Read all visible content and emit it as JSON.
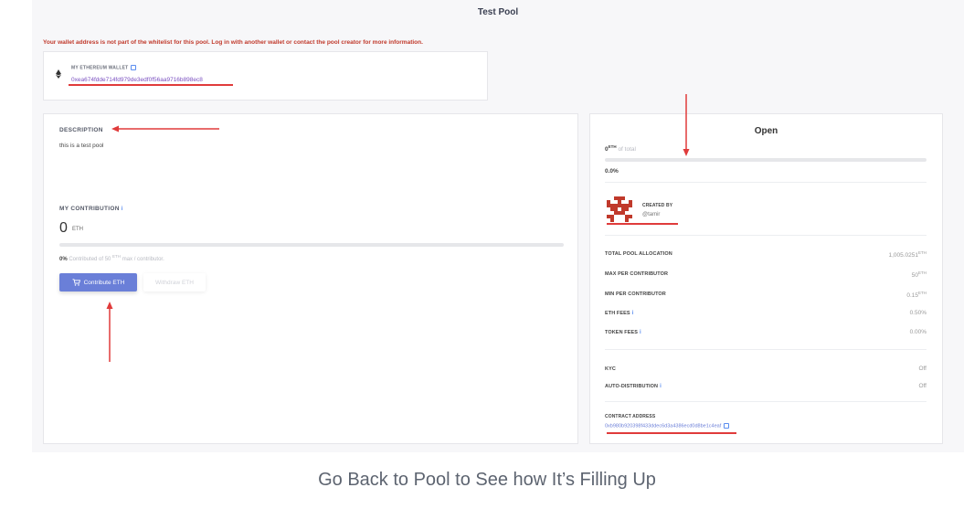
{
  "page": {
    "title": "Test Pool",
    "warning": "Your wallet address is not part of the whitelist for this pool. Log in with another wallet or contact the pool creator for more information."
  },
  "wallet": {
    "label": "MY ETHEREUM WALLET",
    "address": "0xea674fdde714fd979de3edf0f56aa9716b898ec8"
  },
  "description": {
    "label": "DESCRIPTION",
    "text": "this is a test pool"
  },
  "contribution": {
    "label": "MY CONTRIBUTION",
    "value": "0",
    "unit": "ETH",
    "percent": "0%",
    "detail_prefix": "Contributed of 50",
    "detail_unit": "ETH",
    "detail_suffix": "max / contributor.",
    "progress": 0,
    "contribute_label": "Contribute ETH",
    "withdraw_label": "Withdraw ETH"
  },
  "status": {
    "title": "Open",
    "total_value": "0",
    "total_unit": "ETH",
    "total_suffix": "of total",
    "percent": "0.0%",
    "progress": 0
  },
  "creator": {
    "label": "CREATED BY",
    "handle": "@tamir"
  },
  "stats": [
    {
      "label": "TOTAL POOL ALLOCATION",
      "value": "1,005.0251",
      "unit": "ETH",
      "info": false
    },
    {
      "label": "MAX PER CONTRIBUTOR",
      "value": "50",
      "unit": "ETH",
      "info": false
    },
    {
      "label": "MIN PER CONTRIBUTOR",
      "value": "0.15",
      "unit": "ETH",
      "info": false
    },
    {
      "label": "ETH FEES",
      "value": "0.50%",
      "unit": "",
      "info": true
    },
    {
      "label": "TOKEN FEES",
      "value": "0.00%",
      "unit": "",
      "info": true
    }
  ],
  "settings": [
    {
      "label": "KYC",
      "value": "Off",
      "info": false
    },
    {
      "label": "AUTO-DISTRIBUTION",
      "value": "Off",
      "info": true
    }
  ],
  "contract": {
    "label": "CONTRACT ADDRESS",
    "address": "0xb980b920398f433ddec6d3a4386ecd0d8be1c4eaf"
  },
  "caption": "Go Back to Pool to See how It’s Filling Up",
  "colors": {
    "accent": "#6a7fd8",
    "warning": "#c0392b",
    "annotation": "#e03b3b",
    "link": "#5b8def"
  }
}
